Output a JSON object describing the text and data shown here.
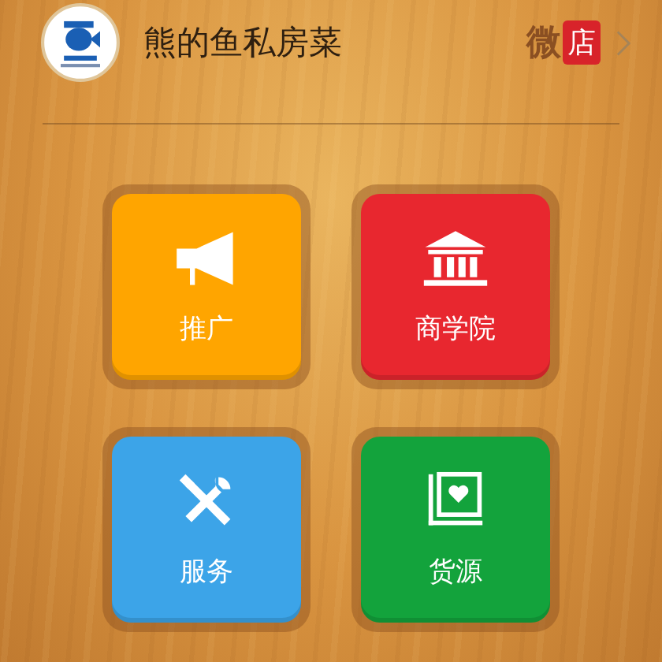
{
  "header": {
    "title": "熊的鱼私房菜",
    "store_link": {
      "prefix": "微",
      "label": "店"
    }
  },
  "tiles": [
    {
      "label": "推广",
      "kind": "megaphone",
      "color": "#ffa500"
    },
    {
      "label": "商学院",
      "kind": "academy",
      "color": "#e8272f"
    },
    {
      "label": "服务",
      "kind": "tools",
      "color": "#3ca4e8"
    },
    {
      "label": "货源",
      "kind": "book",
      "color": "#13a33c"
    }
  ]
}
